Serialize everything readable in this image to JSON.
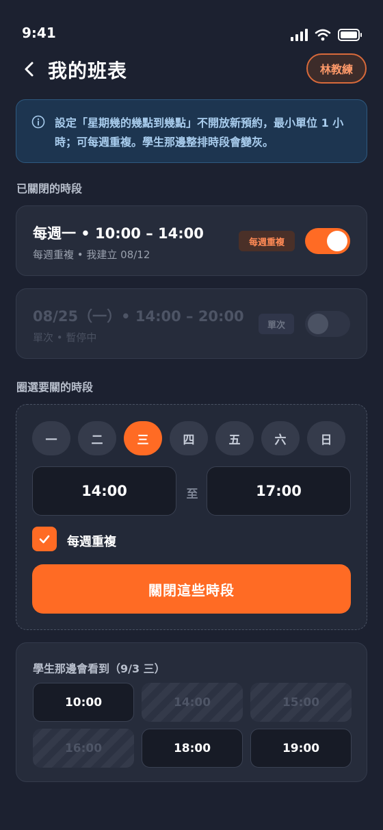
{
  "status_bar": {
    "time": "9:41"
  },
  "header": {
    "title": "我的班表",
    "coach": "林教練"
  },
  "info": {
    "text": "設定「星期幾的幾點到幾點」不開放新預約，最小單位 1 小時；可每週重複。學生那邊整排時段會變灰。"
  },
  "closed_section": {
    "label": "已關閉的時段",
    "slots": [
      {
        "title": "每週一 • 10:00 – 14:00",
        "sub": "每週重複 • 我建立 08/12",
        "tag": "每週重複",
        "enabled": true
      },
      {
        "title": "08/25（一）• 14:00 – 20:00",
        "sub": "單次 • 暫停中",
        "tag": "單次",
        "enabled": false
      }
    ]
  },
  "select_section": {
    "label": "圈選要關的時段",
    "days": [
      "一",
      "二",
      "三",
      "四",
      "五",
      "六",
      "日"
    ],
    "selected_day": "三",
    "start_time": "14:00",
    "to": "至",
    "end_time": "17:00",
    "repeat_label": "每週重複",
    "repeat_checked": true,
    "submit": "關閉這些時段"
  },
  "preview": {
    "title": "學生那邊會看到（9/3 三）",
    "slots": [
      {
        "time": "10:00",
        "open": true
      },
      {
        "time": "14:00",
        "open": false
      },
      {
        "time": "15:00",
        "open": false
      },
      {
        "time": "16:00",
        "open": false
      },
      {
        "time": "18:00",
        "open": true
      },
      {
        "time": "19:00",
        "open": true
      }
    ]
  },
  "colors": {
    "background": "#1c2130",
    "accent": "#ff6b24",
    "info_bg": "#1d3550",
    "info_text": "#a9cdee",
    "coach_text": "#ff9a6a"
  },
  "icons": [
    "back-chevron-icon",
    "signal-icon",
    "wifi-icon",
    "battery-icon",
    "info-icon",
    "check-icon"
  ]
}
